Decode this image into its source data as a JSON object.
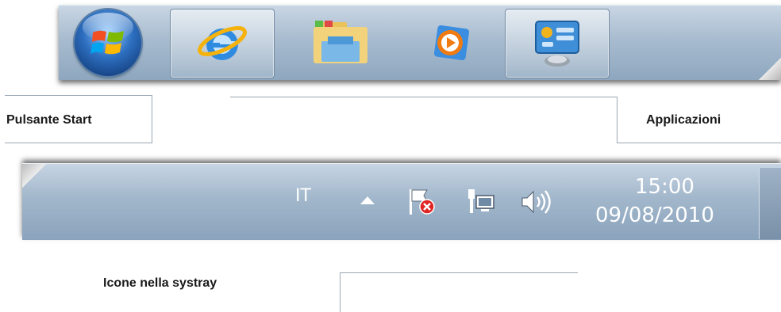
{
  "taskbar": {
    "start_button": {
      "icon": "windows-start-orb-icon"
    },
    "pinned_apps": [
      {
        "id": "internet-explorer",
        "icon": "internet-explorer-icon",
        "active": true
      },
      {
        "id": "windows-explorer",
        "icon": "folder-library-icon",
        "active": false
      },
      {
        "id": "windows-media-player",
        "icon": "media-player-icon",
        "active": false
      },
      {
        "id": "control-panel",
        "icon": "control-panel-icon",
        "active": true
      }
    ]
  },
  "callouts": {
    "start_label": "Pulsante Start",
    "apps_label": "Applicazioni",
    "systray_label": "Icone nella systray"
  },
  "systray": {
    "language": "IT",
    "icons": [
      "show-hidden-icons-arrow-icon",
      "action-center-flag-icon",
      "network-icon",
      "volume-icon"
    ],
    "time": "15:00",
    "date": "09/08/2010"
  },
  "colors": {
    "taskbar_blue": "#a8bccf",
    "label_text": "#1a1a1a",
    "tray_text": "#ffffff"
  }
}
